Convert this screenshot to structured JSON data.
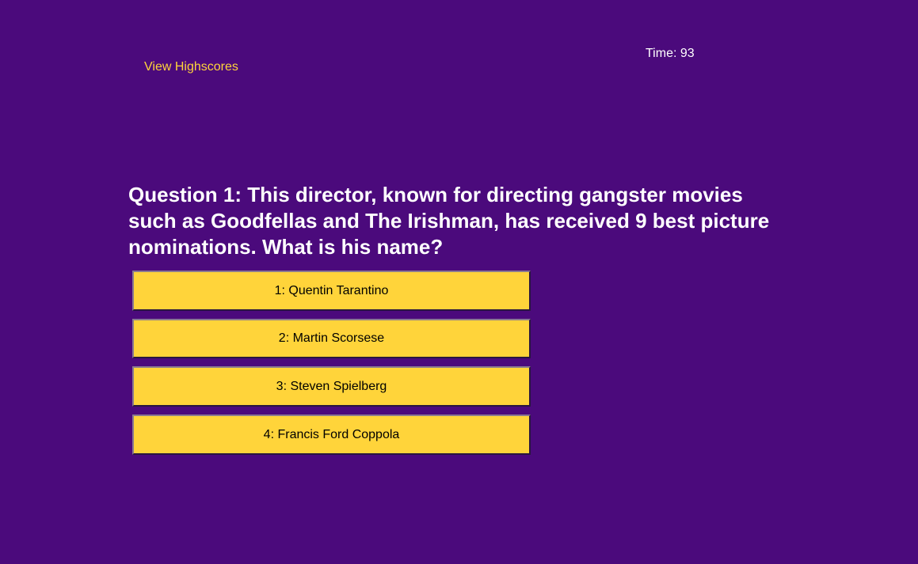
{
  "header": {
    "highscores_link": "View Highscores",
    "timer_label": "Time: 93"
  },
  "quiz": {
    "question": "Question 1: This director, known for directing gangster movies such as Goodfellas and The Irishman, has received 9 best picture nominations. What is his name?",
    "answers": [
      {
        "label": "1: Quentin Tarantino"
      },
      {
        "label": "2: Martin Scorsese"
      },
      {
        "label": "3: Steven Spielberg"
      },
      {
        "label": "4: Francis Ford Coppola"
      }
    ]
  },
  "colors": {
    "background": "#4b0a7c",
    "accent": "#ffd43a",
    "text": "#ffffff"
  }
}
